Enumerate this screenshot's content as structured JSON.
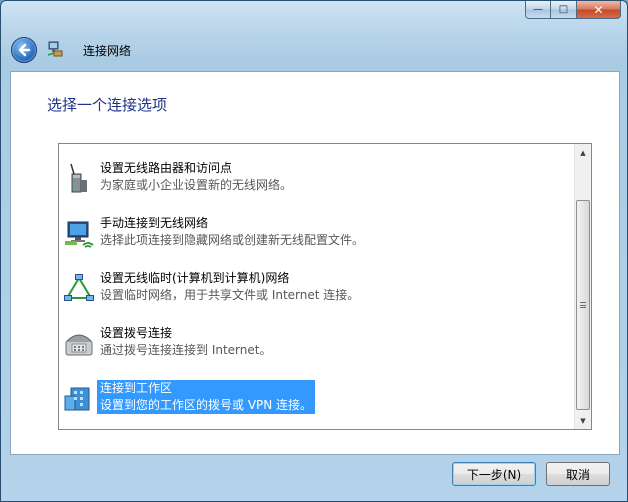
{
  "window": {
    "title": "连接网络",
    "caption_buttons": {
      "minimize": "—",
      "maximize": "□",
      "close": "✕"
    }
  },
  "content": {
    "heading": "选择一个连接选项"
  },
  "options": [
    {
      "title": "设置无线路由器和访问点",
      "desc": "为家庭或小企业设置新的无线网络。",
      "icon": "router-icon",
      "selected": false
    },
    {
      "title": "手动连接到无线网络",
      "desc": "选择此项连接到隐藏网络或创建新无线配置文件。",
      "icon": "wireless-computer-icon",
      "selected": false
    },
    {
      "title": "设置无线临时(计算机到计算机)网络",
      "desc": "设置临时网络，用于共享文件或 Internet 连接。",
      "icon": "adhoc-network-icon",
      "selected": false
    },
    {
      "title": "设置拨号连接",
      "desc": "通过拨号连接连接到 Internet。",
      "icon": "dialup-phone-icon",
      "selected": false
    },
    {
      "title": "连接到工作区",
      "desc": "设置到您的工作区的拨号或 VPN 连接。",
      "icon": "workplace-icon",
      "selected": true
    }
  ],
  "buttons": {
    "next": "下一步(N)",
    "cancel": "取消"
  },
  "colors": {
    "heading": "#1e3287",
    "selection": "#3399ff"
  }
}
